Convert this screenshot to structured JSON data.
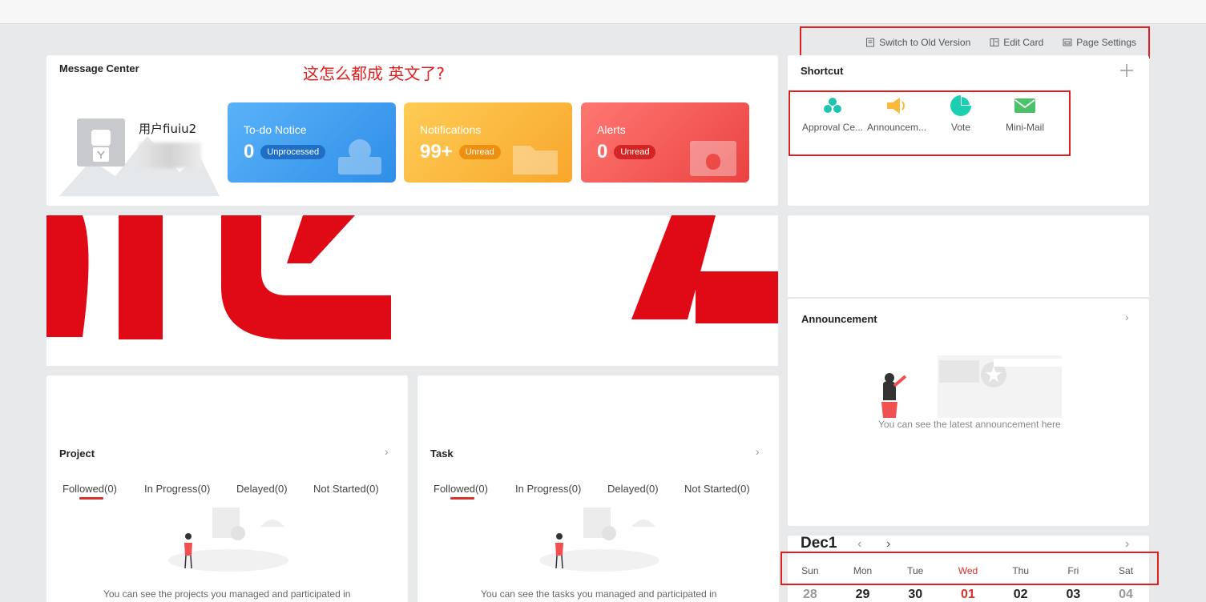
{
  "toolbar": {
    "switch_label": "Switch to Old Version",
    "edit_label": "Edit Card",
    "page_settings_label": "Page Settings"
  },
  "message_center": {
    "title": "Message Center",
    "annotation": "这怎么都成 英文了?",
    "user_name": "用户fiuiu2",
    "tiles": [
      {
        "label": "To-do Notice",
        "count": "0",
        "badge": "Unprocessed"
      },
      {
        "label": "Notifications",
        "count": "99+",
        "badge": "Unread"
      },
      {
        "label": "Alerts",
        "count": "0",
        "badge": "Unread"
      }
    ]
  },
  "shortcut": {
    "title": "Shortcut",
    "items": [
      {
        "label": "Approval Ce...",
        "icon": "approval-icon"
      },
      {
        "label": "Announcem...",
        "icon": "megaphone-icon"
      },
      {
        "label": "Vote",
        "icon": "pie-icon"
      },
      {
        "label": "Mini-Mail",
        "icon": "mail-icon"
      }
    ]
  },
  "announcement": {
    "title": "Announcement",
    "empty_text": "You can see the latest announcement here"
  },
  "project": {
    "title": "Project",
    "tabs": [
      "Followed(0)",
      "In Progress(0)",
      "Delayed(0)",
      "Not Started(0)"
    ],
    "empty_text": "You can see the projects you managed and participated in"
  },
  "task": {
    "title": "Task",
    "tabs": [
      "Followed(0)",
      "In Progress(0)",
      "Delayed(0)",
      "Not Started(0)"
    ],
    "empty_text": "You can see the tasks you managed and participated in"
  },
  "calendar": {
    "month": "Dec1",
    "weekdays": [
      "Sun",
      "Mon",
      "Tue",
      "Wed",
      "Thu",
      "Fri",
      "Sat"
    ],
    "dates": [
      "28",
      "29",
      "30",
      "01",
      "02",
      "03",
      "04"
    ],
    "today_index": 3
  },
  "colors": {
    "accent_red": "#d8322c",
    "annotation_red": "#e02020",
    "todo_blue": "#3c9df0",
    "notif_orange": "#fbb93c",
    "alert_red": "#f0504f"
  }
}
